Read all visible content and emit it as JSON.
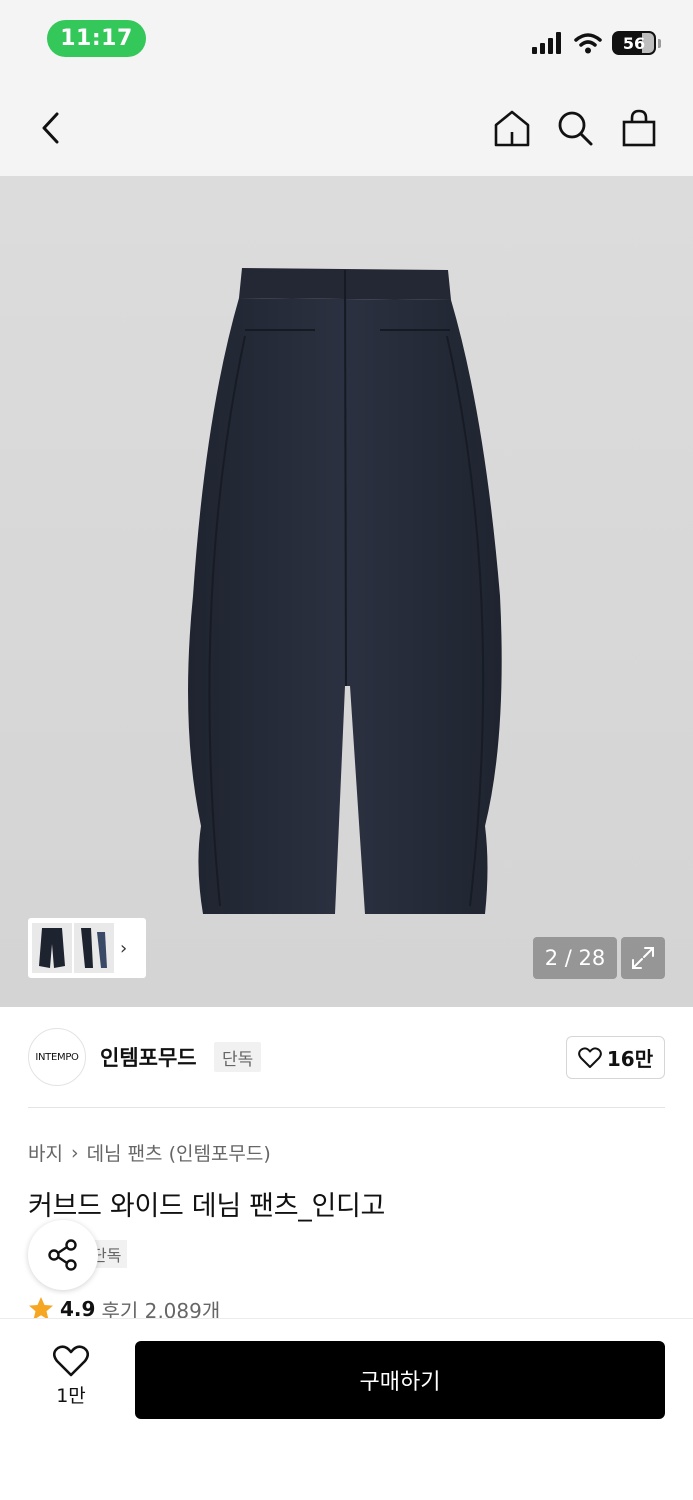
{
  "status_bar": {
    "time": "11:17",
    "battery": "56"
  },
  "gallery": {
    "counter": "2 / 28"
  },
  "brand": {
    "logo_text": "INTEMPO",
    "name": "인템포무드",
    "tag": "단독",
    "likes": "16만"
  },
  "product": {
    "breadcrumb": [
      "바지",
      "데님 팬츠 (인템포무드)"
    ],
    "title": "커브드 와이드 데님 팬츠_인디고",
    "tag": "단독",
    "rating": "4.9",
    "reviews": "후기 2,089개"
  },
  "bottom_bar": {
    "wish_count": "1만",
    "buy_label": "구매하기"
  },
  "colors": {
    "status_green": "#34c759",
    "star": "#f5a623",
    "buy_button": "#000000"
  },
  "icons": [
    "back-icon",
    "home-icon",
    "search-icon",
    "shopping-bag-icon",
    "expand-icon",
    "heart-icon",
    "share-icon",
    "star-icon",
    "chevron-right-icon"
  ]
}
